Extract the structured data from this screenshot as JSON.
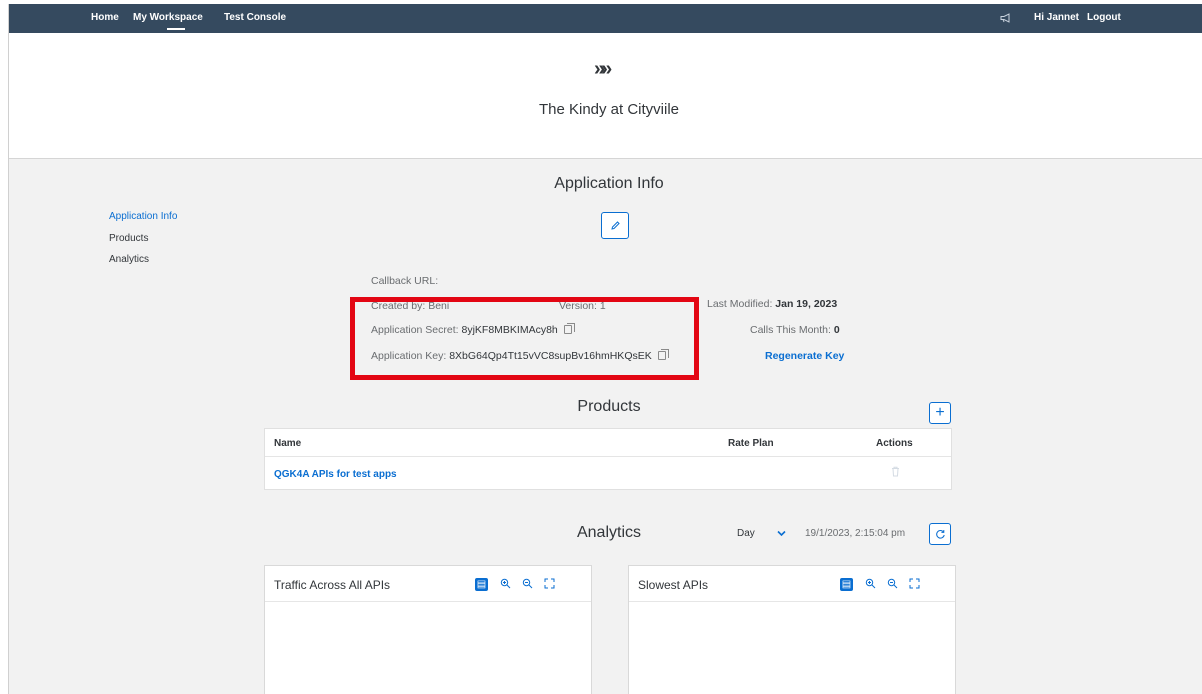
{
  "topbar": {
    "nav": [
      "Home",
      "My Workspace",
      "Test Console"
    ],
    "greeting": "Hi Jannet",
    "logout": "Logout",
    "notification_icon": "megaphone-icon"
  },
  "header": {
    "logo_glyph": "»»",
    "app_name": "The Kindy at Cityviile"
  },
  "sidebar": {
    "items": [
      {
        "label": "Application Info",
        "active": true
      },
      {
        "label": "Products",
        "active": false
      },
      {
        "label": "Analytics",
        "active": false
      }
    ]
  },
  "app_info": {
    "title": "Application Info",
    "edit_icon": "pencil-icon",
    "callback_label": "Callback URL:",
    "created_by_label": "Created by: Beni",
    "version_label": "Version: 1",
    "last_modified_label": "Last Modified:",
    "last_modified_value": "Jan 19, 2023",
    "secret_label": "Application Secret:",
    "secret_value": "8yjKF8MBKIMAcy8h",
    "calls_label": "Calls This Month:",
    "calls_value": "0",
    "key_label": "Application Key:",
    "key_value": "8XbG64Qp4Tt15vVC8supBv16hmHKQsEK",
    "regenerate_label": "Regenerate Key",
    "highlight_color": "#e30613"
  },
  "products": {
    "title": "Products",
    "add_icon": "plus-icon",
    "columns": [
      "Name",
      "Rate Plan",
      "Actions"
    ],
    "rows": [
      {
        "name": "QGK4A APIs for test apps",
        "rate_plan": "",
        "action_icon": "trash-icon"
      }
    ]
  },
  "analytics": {
    "title": "Analytics",
    "period": "Day",
    "timestamp": "19/1/2023, 2:15:04 pm",
    "refresh_icon": "refresh-icon",
    "panels": [
      {
        "title": "Traffic Across All APIs"
      },
      {
        "title": "Slowest APIs"
      }
    ],
    "panel_tools": [
      "table-view-icon",
      "zoom-in-icon",
      "zoom-out-icon",
      "fullscreen-icon"
    ]
  },
  "colors": {
    "shell_bar": "#354a5f",
    "accent": "#0a6ed1",
    "background": "#f2f2f2"
  }
}
